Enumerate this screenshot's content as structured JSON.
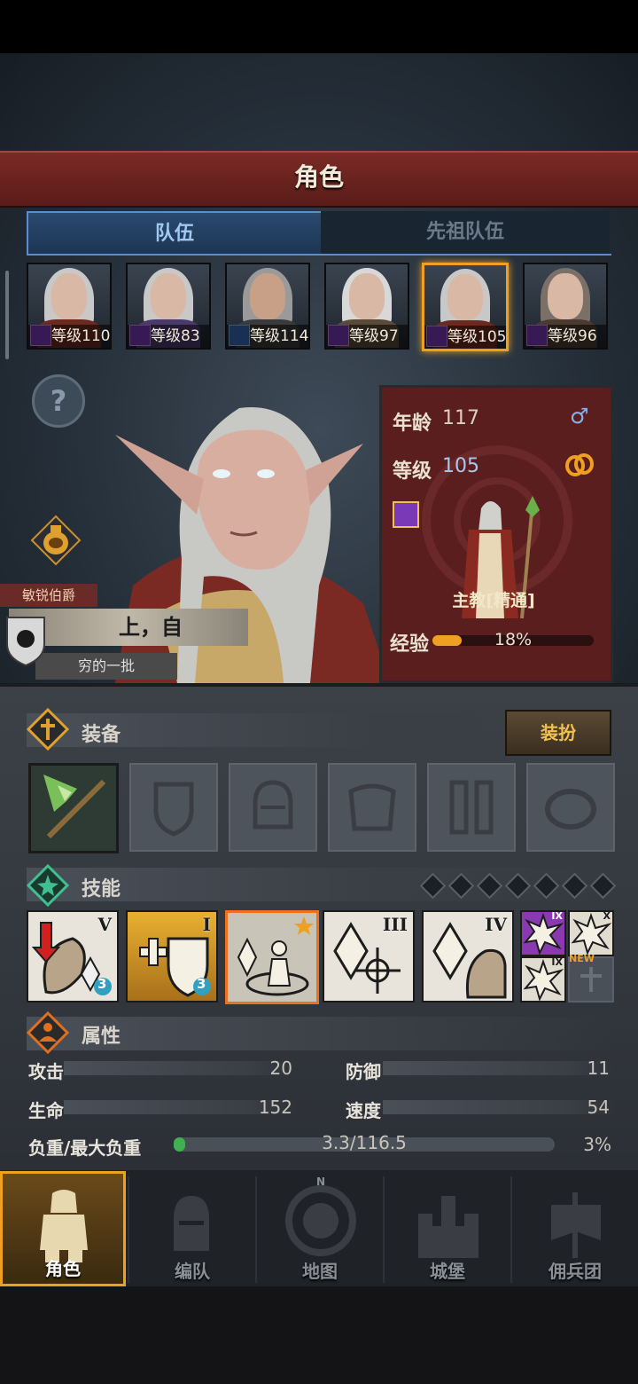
{
  "header": {
    "title": "角色"
  },
  "tabs": [
    {
      "label": "队伍",
      "active": true
    },
    {
      "label": "先祖队伍",
      "active": false
    }
  ],
  "roster": [
    {
      "level_label": "等级110",
      "class_color": "purple",
      "selected": false
    },
    {
      "level_label": "等级83",
      "class_color": "purple",
      "selected": false
    },
    {
      "level_label": "等级114",
      "class_color": "blue",
      "selected": false
    },
    {
      "level_label": "等级97",
      "class_color": "purple",
      "selected": false
    },
    {
      "level_label": "等级105",
      "class_color": "purple",
      "selected": true
    },
    {
      "level_label": "等级96",
      "class_color": "purple",
      "selected": false
    }
  ],
  "hero": {
    "title_tag": "敏锐伯爵",
    "name": "上，自",
    "epithet": "穷的一批",
    "age_label": "年龄",
    "age": "117",
    "level_label": "等级",
    "level": "105",
    "class_name": "主教[精通]",
    "exp_label": "经验",
    "exp_percent": "18%",
    "exp_fraction": 0.18,
    "gender_icon": "male-icon",
    "marriage_icon": "rings-icon"
  },
  "equipment": {
    "title": "装备",
    "dress_button": "装扮",
    "slots": [
      "weapon-staff",
      "shield-slot",
      "helmet-slot",
      "armor-slot",
      "boots-slot",
      "ring-slot"
    ]
  },
  "skills": {
    "title": "技能",
    "points_filled": 0,
    "points_total": 7,
    "items": [
      {
        "rank": "V",
        "badge": "3"
      },
      {
        "rank": "I",
        "badge": "3"
      },
      {
        "rank": "",
        "badge": ""
      },
      {
        "rank": "III",
        "badge": ""
      },
      {
        "rank": "IV",
        "badge": ""
      }
    ],
    "mini": [
      {
        "rank": "IX"
      },
      {
        "rank": "X"
      },
      {
        "rank": "IX",
        "tag": "NEW"
      },
      {
        "rank": ""
      }
    ]
  },
  "attributes": {
    "title": "属性",
    "attack_label": "攻击",
    "attack": "20",
    "defense_label": "防御",
    "defense": "11",
    "hp_label": "生命",
    "hp": "152",
    "speed_label": "速度",
    "speed": "54",
    "load_label": "负重/最大负重",
    "load": "3.3/116.5",
    "load_percent": "3%",
    "load_fraction": 0.03
  },
  "nav": [
    {
      "label": "角色",
      "active": true
    },
    {
      "label": "编队",
      "active": false
    },
    {
      "label": "地图",
      "active": false
    },
    {
      "label": "城堡",
      "active": false
    },
    {
      "label": "佣兵团",
      "active": false
    }
  ],
  "colors": {
    "accent": "#f0a020",
    "title_red": "#7a2a25",
    "tab_blue": "#5a8ed0",
    "level_blue": "#a8c8f0"
  }
}
